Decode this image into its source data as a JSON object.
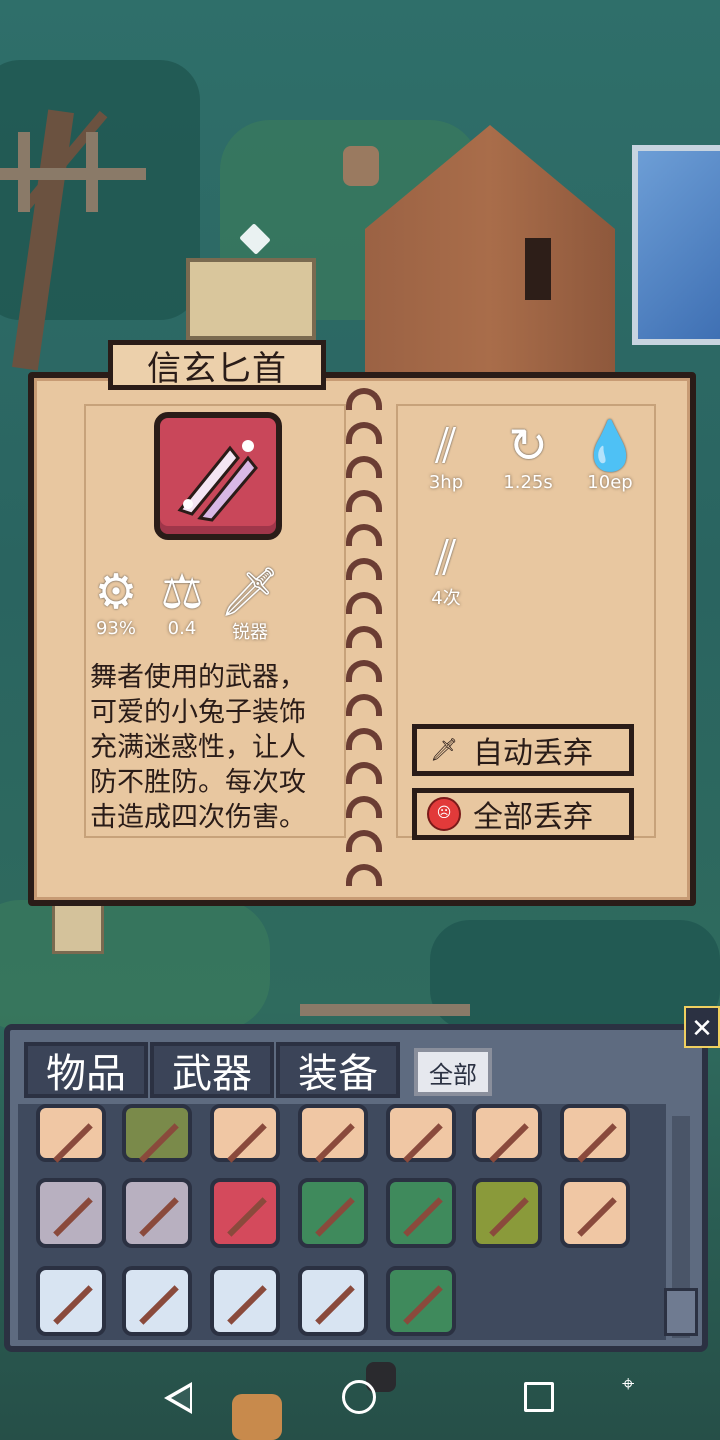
{
  "item": {
    "name": "信玄匕首",
    "description": "舞者使用的武器，可爱的小兔子装饰充满迷惑性，让人防不胜防。每次攻击造成四次伤害。",
    "description_lines": [
      "舞者使用的武器，",
      "可爱的小兔子装饰",
      "充满迷惑性，让人",
      "防不胜防。每次攻",
      "击造成四次伤害。"
    ],
    "stats_left": [
      {
        "icon": "precision-gear-icon",
        "value": "93%"
      },
      {
        "icon": "weight-icon",
        "value": "0.4"
      },
      {
        "icon": "sharp-blade-icon",
        "value": "锐器"
      }
    ],
    "stats_right": [
      {
        "icon": "slash-damage-icon",
        "value": "3hp"
      },
      {
        "icon": "cooldown-timer-icon",
        "value": "1.25s"
      },
      {
        "icon": "energy-drop-icon",
        "value": "10ep"
      },
      {
        "icon": "multi-slash-icon",
        "value": "4次"
      }
    ],
    "frame_color": "#c9475a"
  },
  "buttons": {
    "auto_drop": "自动丢弃",
    "drop_all": "全部丢弃"
  },
  "inventory": {
    "tabs": [
      "物品",
      "武器",
      "装备"
    ],
    "filter": "全部",
    "close": "✕",
    "slots": [
      {
        "icon": "axe-icon",
        "color": "#f0c7a4"
      },
      {
        "icon": "ammo-box-icon",
        "color": "#7a8a4a"
      },
      {
        "icon": "bat-icon",
        "color": "#f0c7a4"
      },
      {
        "icon": "bat-icon",
        "color": "#f0c7a4"
      },
      {
        "icon": "spear-icon",
        "color": "#f0c7a4"
      },
      {
        "icon": "spear-icon",
        "color": "#f0c7a4"
      },
      {
        "icon": "staff-icon",
        "color": "#f0c7a4"
      },
      {
        "icon": "flame-sword-icon",
        "color": "#b8b0c0"
      },
      {
        "icon": "flame-sword-icon",
        "color": "#b8b0c0"
      },
      {
        "icon": "bunny-dagger-icon",
        "color": "#d44a5c"
      },
      {
        "icon": "rifle-icon",
        "color": "#3f8a5c"
      },
      {
        "icon": "rifle-icon",
        "color": "#3f8a5c"
      },
      {
        "icon": "revolver-icon",
        "color": "#8a9a3a"
      },
      {
        "icon": "hand-axe-icon",
        "color": "#f0c7a4"
      },
      {
        "icon": "chainsaw-sword-icon",
        "color": "#d8e4f2"
      },
      {
        "icon": "bazooka-icon",
        "color": "#d8e4f2"
      },
      {
        "icon": "golden-blaster-icon",
        "color": "#d8e4f2"
      },
      {
        "icon": "lightning-blaster-icon",
        "color": "#d8e4f2"
      },
      {
        "icon": "assault-rifle-icon",
        "color": "#3f8a5c"
      }
    ]
  },
  "navbar": {
    "back": "back-icon",
    "home": "home-icon",
    "recents": "recents-icon",
    "location": "location-icon"
  }
}
